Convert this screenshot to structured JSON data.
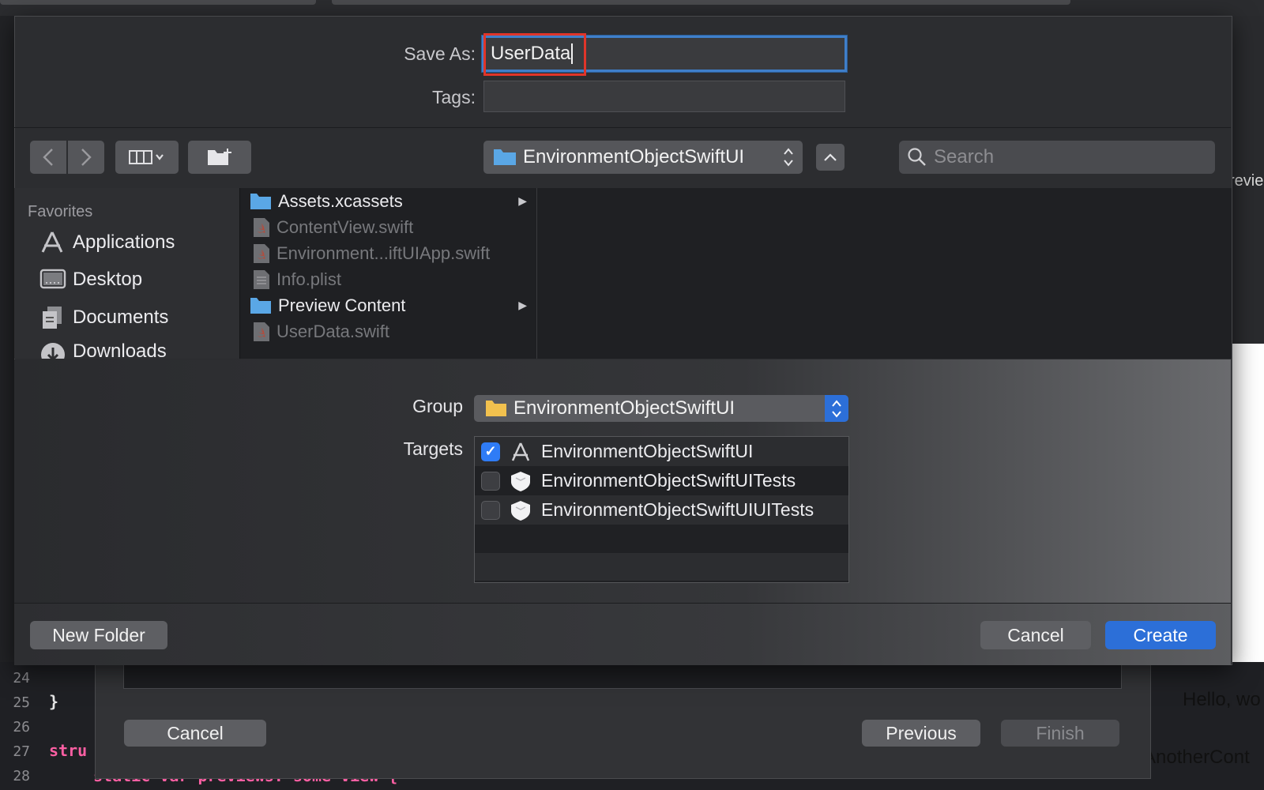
{
  "save_panel": {
    "save_as_label": "Save As:",
    "save_as_value": "UserData",
    "tags_label": "Tags:",
    "tags_value": "",
    "location": "EnvironmentObjectSwiftUI",
    "search_placeholder": "Search",
    "favorites": {
      "title": "Favorites",
      "items": [
        {
          "label": "Applications",
          "icon": "applications-icon"
        },
        {
          "label": "Desktop",
          "icon": "desktop-icon"
        },
        {
          "label": "Documents",
          "icon": "documents-icon"
        },
        {
          "label": "Downloads",
          "icon": "downloads-icon"
        }
      ]
    },
    "files": [
      {
        "name": "Assets.xcassets",
        "kind": "folder",
        "expandable": true
      },
      {
        "name": "ContentView.swift",
        "kind": "swift",
        "expandable": false
      },
      {
        "name": "Environment...iftUIApp.swift",
        "kind": "swift",
        "expandable": false
      },
      {
        "name": "Info.plist",
        "kind": "plist",
        "expandable": false
      },
      {
        "name": "Preview Content",
        "kind": "folder",
        "expandable": true
      },
      {
        "name": "UserData.swift",
        "kind": "swift",
        "expandable": false
      }
    ],
    "group_label": "Group",
    "group_value": "EnvironmentObjectSwiftUI",
    "targets_label": "Targets",
    "targets": [
      {
        "name": "EnvironmentObjectSwiftUI",
        "checked": true,
        "icon": "app-target-icon"
      },
      {
        "name": "EnvironmentObjectSwiftUITests",
        "checked": false,
        "icon": "test-target-icon"
      },
      {
        "name": "EnvironmentObjectSwiftUIUITests",
        "checked": false,
        "icon": "test-target-icon"
      }
    ],
    "new_folder_label": "New Folder",
    "cancel_label": "Cancel",
    "create_label": "Create"
  },
  "background": {
    "line_numbers": [
      "24",
      "25",
      "26",
      "27",
      "28"
    ],
    "code_lines": [
      "",
      "}",
      "",
      "stru",
      "static var previews: some View {"
    ],
    "template_sheet": {
      "cancel_label": "Cancel",
      "previous_label": "Previous",
      "finish_label": "Finish"
    },
    "preview_side_text": "revie",
    "preview_hello": "Hello, wo",
    "preview_another": "AnotherCont"
  },
  "colors": {
    "accent": "#2c6fd8",
    "focus_ring": "#3f7fc9",
    "highlight_box": "#e0352a",
    "folder_blue": "#5aa7e6",
    "folder_yellow": "#f2c14e"
  }
}
